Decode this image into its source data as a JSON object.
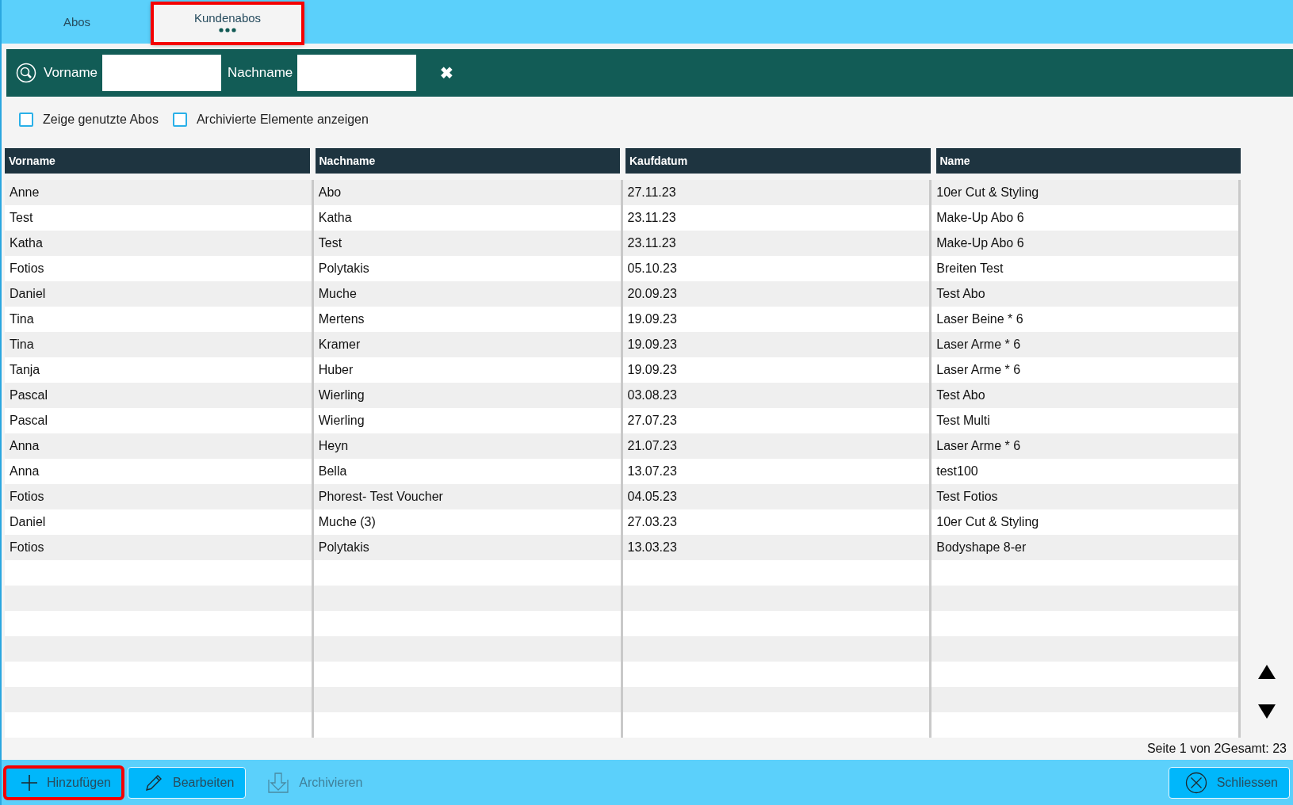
{
  "tabs": [
    {
      "label": "Abos",
      "selected": false,
      "highlighted": false
    },
    {
      "label": "Kundenabos",
      "selected": true,
      "highlighted": true
    }
  ],
  "filter": {
    "fields": [
      {
        "label": "Vorname"
      },
      {
        "label": "Nachname"
      }
    ],
    "clear": "✖"
  },
  "options": [
    {
      "label": "Zeige genutzte Abos",
      "checked": false
    },
    {
      "label": "Archivierte Elemente anzeigen",
      "checked": false
    }
  ],
  "table": {
    "columns": [
      "Vorname",
      "Nachname",
      "Kaufdatum",
      "Name"
    ],
    "rows": [
      [
        "Anne",
        "Abo",
        "27.11.23",
        "10er Cut & Styling"
      ],
      [
        "Test",
        "Katha",
        "23.11.23",
        "Make-Up Abo 6"
      ],
      [
        "Katha",
        "Test",
        "23.11.23",
        "Make-Up Abo 6"
      ],
      [
        "Fotios",
        "Polytakis",
        "05.10.23",
        "Breiten Test"
      ],
      [
        "Daniel",
        "Muche",
        "20.09.23",
        "Test Abo"
      ],
      [
        "Tina",
        "Mertens",
        "19.09.23",
        "Laser Beine * 6"
      ],
      [
        "Tina",
        "Kramer",
        "19.09.23",
        "Laser Arme * 6"
      ],
      [
        "Tanja",
        "Huber",
        "19.09.23",
        "Laser Arme * 6"
      ],
      [
        "Pascal",
        "Wierling",
        "03.08.23",
        "Test Abo"
      ],
      [
        "Pascal",
        "Wierling",
        "27.07.23",
        "Test Multi"
      ],
      [
        "Anna",
        "Heyn",
        "21.07.23",
        "Laser Arme * 6"
      ],
      [
        "Anna",
        "Bella",
        "13.07.23",
        "test100"
      ],
      [
        "Fotios",
        "Phorest- Test Voucher",
        "04.05.23",
        "Test Fotios"
      ],
      [
        "Daniel",
        "Muche (3)",
        "27.03.23",
        "10er Cut & Styling"
      ],
      [
        "Fotios",
        "Polytakis",
        "13.03.23",
        "Bodyshape 8-er"
      ]
    ]
  },
  "pager": "Seite 1 von 2Gesamt: 23",
  "buttons": [
    {
      "kind": "add",
      "label": "Hinzufügen",
      "disabled": false,
      "highlighted": true
    },
    {
      "kind": "edit",
      "label": "Bearbeiten",
      "disabled": false,
      "highlighted": false
    },
    {
      "kind": "archive",
      "label": "Archivieren",
      "disabled": true,
      "highlighted": false
    }
  ],
  "close_button": "Schliessen"
}
